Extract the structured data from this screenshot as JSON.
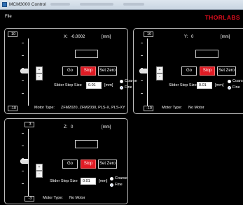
{
  "window": {
    "title": "MCM3000 Control"
  },
  "menu": {
    "file": "File"
  },
  "brand": {
    "text": "THORLABS",
    "color": "#e10e1e"
  },
  "labels": {
    "unit": "[mm]",
    "slider_step_size": "Slider Step Size",
    "coarse": "Coarse",
    "fine": "Fine",
    "motor_type": "Motor Type:",
    "go": "Go",
    "stop": "Stop",
    "set_zero": "Set Zero",
    "jog_up": "+",
    "jog_down": "-"
  },
  "colors": {
    "background": "#000000",
    "stop_button": "#e01b24",
    "panel_border": "#bdbdbd"
  },
  "axes": {
    "x": {
      "name": "X:",
      "position": "-0.0002",
      "slider_max": "10",
      "slider_min": "-10",
      "slider_level": 0.5,
      "position_input": "",
      "step_size": "0.01",
      "step_unit": "[mm]",
      "selected_mode": "fine",
      "motor_type": "ZFM2020, ZFM2030, PLS-X, PLS-XY"
    },
    "y": {
      "name": "Y:",
      "position": "0",
      "slider_max": "10",
      "slider_min": "-10",
      "slider_level": 0.5,
      "position_input": "",
      "step_size": "0.01",
      "step_unit": "[mm]",
      "selected_mode": "fine",
      "motor_type": "No Motor"
    },
    "z": {
      "name": "Z:",
      "position": "0",
      "slider_max": "3",
      "slider_min": "-3",
      "slider_level": 0.5,
      "position_input": "",
      "step_size": "0.01",
      "step_unit": "[mm]",
      "selected_mode": "fine",
      "motor_type": "No Motor"
    }
  }
}
